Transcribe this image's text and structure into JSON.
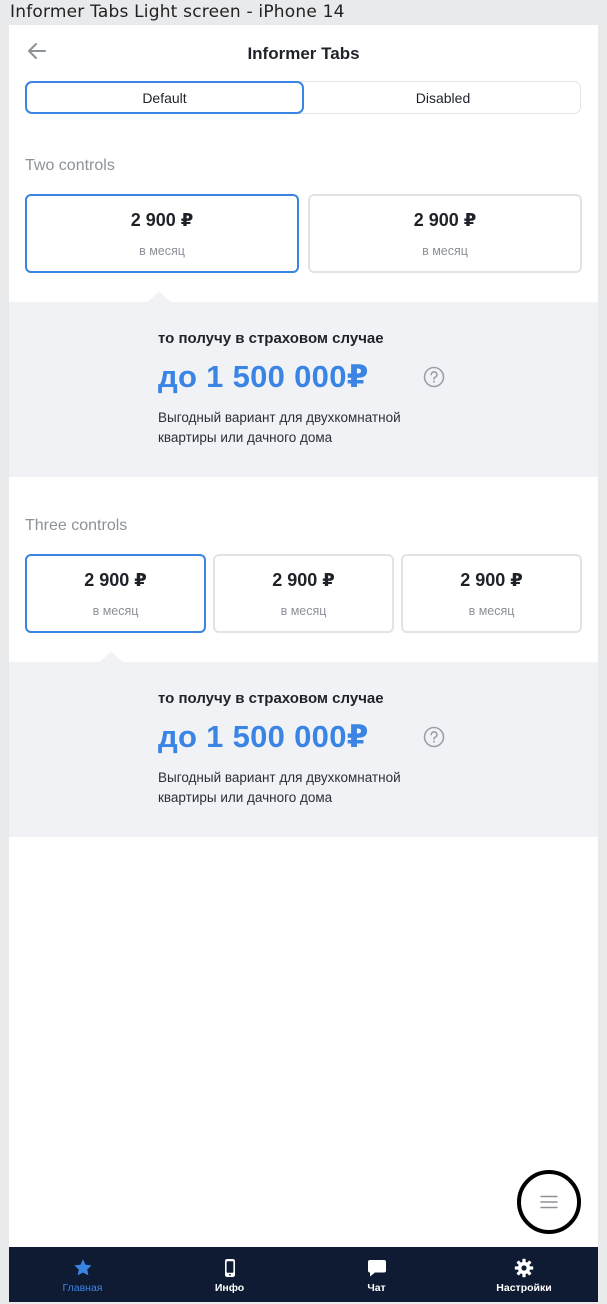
{
  "frame_caption": "Informer Tabs Light screen - iPhone 14",
  "header": {
    "title": "Informer Tabs"
  },
  "segmented": {
    "options": [
      "Default",
      "Disabled"
    ],
    "selected": "Default"
  },
  "sections": [
    {
      "title": "Two controls",
      "cards": [
        {
          "amount": "2 900 ₽",
          "period": "в месяц",
          "selected": true
        },
        {
          "amount": "2 900 ₽",
          "period": "в месяц",
          "selected": false
        }
      ],
      "informer": {
        "lead": "то получу в страховом случае",
        "amount": "до 1 500 000₽",
        "description_line1": "Выгодный вариант для  двухкомнатной",
        "description_line2": "квартиры или дачного дома"
      }
    },
    {
      "title": "Three controls",
      "cards": [
        {
          "amount": "2 900 ₽",
          "period": "в месяц",
          "selected": true
        },
        {
          "amount": "2 900 ₽",
          "period": "в месяц",
          "selected": false
        },
        {
          "amount": "2 900 ₽",
          "period": "в месяц",
          "selected": false
        }
      ],
      "informer": {
        "lead": "то получу в страховом случае",
        "amount": "до 1 500 000₽",
        "description_line1": "Выгодный вариант для  двухкомнатной",
        "description_line2": "квартиры или дачного дома"
      }
    }
  ],
  "tabbar": {
    "items": [
      {
        "label": "Главная",
        "icon": "star-icon",
        "active": true
      },
      {
        "label": "Инфо",
        "icon": "phone-icon",
        "active": false
      },
      {
        "label": "Чат",
        "icon": "chat-icon",
        "active": false
      },
      {
        "label": "Настройки",
        "icon": "gear-icon",
        "active": false
      }
    ]
  },
  "colors": {
    "accent": "#3a84e3",
    "tabbar_bg": "#0f1b33",
    "informer_bg": "#f1f2f5",
    "muted_text": "#8d9198"
  },
  "fab": {
    "icon": "menu-icon"
  }
}
